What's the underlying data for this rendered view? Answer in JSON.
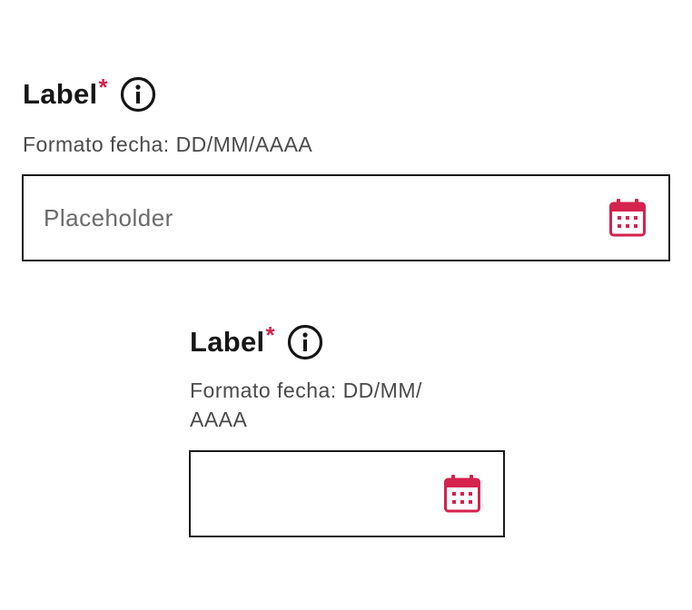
{
  "field_wide": {
    "label": "Label",
    "required_mark": "*",
    "info_icon": "info-circle-icon",
    "helper": "Formato fecha: DD/MM/AAAA",
    "input_value": "",
    "placeholder": "Placeholder",
    "calendar_icon": "calendar-icon"
  },
  "field_narrow": {
    "label": "Label",
    "required_mark": "*",
    "info_icon": "info-circle-icon",
    "helper_line1": "Formato fecha: DD/MM/",
    "helper_line2": "AAAA",
    "input_value": "",
    "placeholder": "",
    "calendar_icon": "calendar-icon"
  },
  "colors": {
    "required": "#d4234e",
    "calendar_icon": "#d4234e",
    "border": "#1a1a1a",
    "helper_text": "#4a4a4a",
    "placeholder_text": "#6b6b6b"
  }
}
